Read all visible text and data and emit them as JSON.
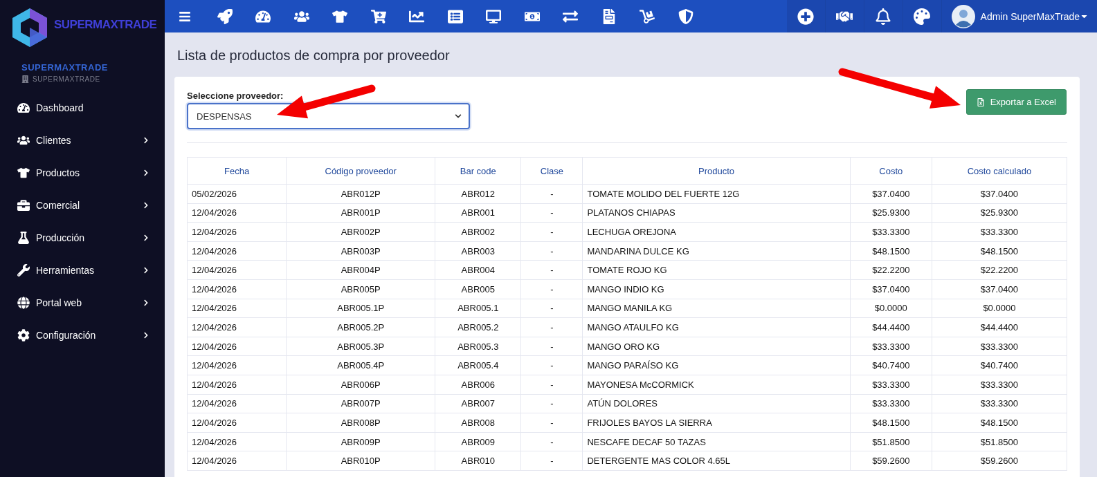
{
  "logo": {
    "text": "SUPERMAXTRADE"
  },
  "topbar": {
    "user": {
      "name": "Admin SuperMaxTrade"
    }
  },
  "sidebar": {
    "company": "SUPERMAXTRADE",
    "branch": "SUPERMAXTRADE",
    "items": [
      {
        "label": "Dashboard",
        "expandable": false
      },
      {
        "label": "Clientes",
        "expandable": true
      },
      {
        "label": "Productos",
        "expandable": true
      },
      {
        "label": "Comercial",
        "expandable": true
      },
      {
        "label": "Producción",
        "expandable": true
      },
      {
        "label": "Herramientas",
        "expandable": true
      },
      {
        "label": "Portal web",
        "expandable": true
      },
      {
        "label": "Configuración",
        "expandable": true
      }
    ]
  },
  "page": {
    "title": "Lista de productos de compra por proveedor"
  },
  "filter": {
    "label": "Seleccione proveedor:",
    "value": "DESPENSAS"
  },
  "export_button": {
    "label": "Exportar a Excel"
  },
  "table": {
    "columns": [
      "Fecha",
      "Código proveedor",
      "Bar code",
      "Clase",
      "Producto",
      "Costo",
      "Costo calculado"
    ],
    "rows": [
      [
        "05/02/2026",
        "ABR012P",
        "ABR012",
        "-",
        "TOMATE MOLIDO DEL FUERTE 12G",
        "$37.0400",
        "$37.0400"
      ],
      [
        "12/04/2026",
        "ABR001P",
        "ABR001",
        "-",
        "PLATANOS CHIAPAS",
        "$25.9300",
        "$25.9300"
      ],
      [
        "12/04/2026",
        "ABR002P",
        "ABR002",
        "-",
        "LECHUGA OREJONA",
        "$33.3300",
        "$33.3300"
      ],
      [
        "12/04/2026",
        "ABR003P",
        "ABR003",
        "-",
        "MANDARINA DULCE KG",
        "$48.1500",
        "$48.1500"
      ],
      [
        "12/04/2026",
        "ABR004P",
        "ABR004",
        "-",
        "TOMATE ROJO KG",
        "$22.2200",
        "$22.2200"
      ],
      [
        "12/04/2026",
        "ABR005P",
        "ABR005",
        "-",
        "MANGO INDIO KG",
        "$37.0400",
        "$37.0400"
      ],
      [
        "12/04/2026",
        "ABR005.1P",
        "ABR005.1",
        "-",
        "MANGO MANILA KG",
        "$0.0000",
        "$0.0000"
      ],
      [
        "12/04/2026",
        "ABR005.2P",
        "ABR005.2",
        "-",
        "MANGO ATAULFO KG",
        "$44.4400",
        "$44.4400"
      ],
      [
        "12/04/2026",
        "ABR005.3P",
        "ABR005.3",
        "-",
        "MANGO ORO KG",
        "$33.3300",
        "$33.3300"
      ],
      [
        "12/04/2026",
        "ABR005.4P",
        "ABR005.4",
        "-",
        "MANGO PARAÍSO KG",
        "$40.7400",
        "$40.7400"
      ],
      [
        "12/04/2026",
        "ABR006P",
        "ABR006",
        "-",
        "MAYONESA McCORMICK",
        "$33.3300",
        "$33.3300"
      ],
      [
        "12/04/2026",
        "ABR007P",
        "ABR007",
        "-",
        "ATÚN DOLORES",
        "$33.3300",
        "$33.3300"
      ],
      [
        "12/04/2026",
        "ABR008P",
        "ABR008",
        "-",
        "FRIJOLES BAYOS LA SIERRA",
        "$48.1500",
        "$48.1500"
      ],
      [
        "12/04/2026",
        "ABR009P",
        "ABR009",
        "-",
        "NESCAFE DECAF 50 TAZAS",
        "$51.8500",
        "$51.8500"
      ],
      [
        "12/04/2026",
        "ABR010P",
        "ABR010",
        "-",
        "DETERGENTE MAS COLOR 4.65L",
        "$59.2600",
        "$59.2600"
      ]
    ]
  }
}
